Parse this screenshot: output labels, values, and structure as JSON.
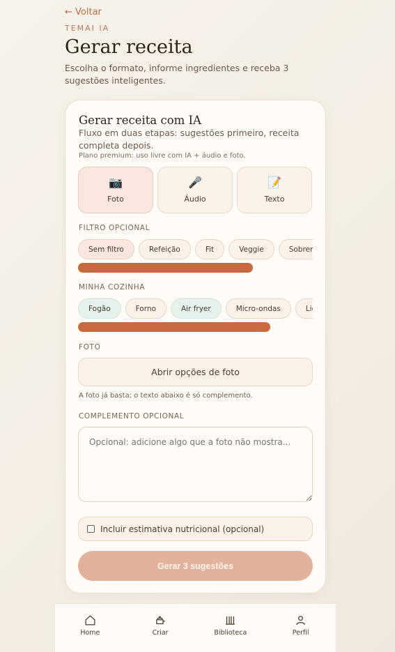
{
  "header": {
    "back_label": "← Voltar",
    "eyebrow": "TEMAI IA",
    "title": "Gerar receita",
    "subtitle": "Escolha o formato, informe ingredientes e receba 3 sugestões inteligentes."
  },
  "card": {
    "title": "Gerar receita com IA",
    "description": "Fluxo em duas etapas: sugestões primeiro, receita completa depois.",
    "premium_note": "Plano premium: uso livre com IA + áudio e foto.",
    "modes": [
      {
        "label": "Foto",
        "icon": "camera-icon",
        "glyph": "📷",
        "active": true
      },
      {
        "label": "Áudio",
        "icon": "microphone-icon",
        "glyph": "🎤",
        "active": false
      },
      {
        "label": "Texto",
        "icon": "memo-icon",
        "glyph": "📝",
        "active": false
      }
    ],
    "filter": {
      "label": "FILTRO OPCIONAL",
      "chips": [
        "Sem filtro",
        "Refeição",
        "Fit",
        "Veggie",
        "Sobremesa"
      ],
      "selected": "Sem filtro"
    },
    "kitchen": {
      "label": "MINHA COZINHA",
      "chips": [
        "Fogão",
        "Forno",
        "Air fryer",
        "Micro-ondas",
        "Liquidificador"
      ],
      "selected": [
        "Fogão",
        "Air fryer"
      ]
    },
    "photo": {
      "label": "FOTO",
      "button_label": "Abrir opções de foto",
      "hint": "A foto já basta; o texto abaixo é só complemento."
    },
    "complement": {
      "label": "COMPLEMENTO OPCIONAL",
      "placeholder": "Opcional: adicione algo que a foto não mostra...",
      "value": ""
    },
    "nutrition": {
      "label": "Incluir estimativa nutricional (opcional)",
      "checked": false
    },
    "submit_label": "Gerar 3 sugestões"
  },
  "nav": [
    {
      "label": "Home",
      "icon": "home-icon"
    },
    {
      "label": "Criar",
      "icon": "create-icon"
    },
    {
      "label": "Biblioteca",
      "icon": "library-icon"
    },
    {
      "label": "Perfil",
      "icon": "profile-icon"
    }
  ],
  "colors": {
    "accent": "#c8693f",
    "submit_bg": "#e3b29d",
    "active_filter": "#f8e6df",
    "active_kitchen": "#e6f3ec"
  }
}
